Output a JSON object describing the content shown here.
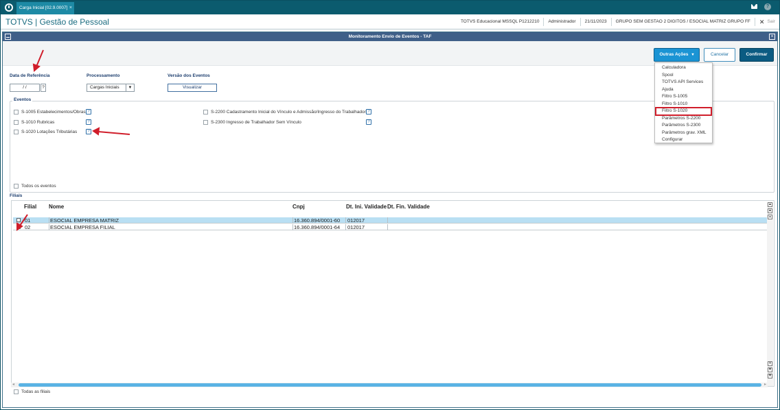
{
  "topbar": {
    "tab_label": "Carga Inicial [02.9.0007]",
    "tab_close": "×"
  },
  "module": {
    "title": "TOTVS | Gestão de Pessoal",
    "environment": "TOTVS Educacional MSSQL P1212210",
    "user": "Administrador",
    "date": "21/11/2023",
    "company": "GRUPO SEM GESTAO 2 DIGITOS / ESOCIAL MATRIZ GRUPO FF",
    "close": "✕",
    "exit": "Sair"
  },
  "dialog": {
    "title": "Monitoramento Envio de Eventos - TAF",
    "close": "×"
  },
  "actions": {
    "outras": "Outras Ações",
    "outras_chevron": "▾",
    "cancelar": "Cancelar",
    "confirmar": "Confirmar"
  },
  "menu": [
    "Calculadora",
    "Spool",
    "TOTVS API Services",
    "Ajuda",
    "Filtro S-1005",
    "Filtro S-1010",
    "Filtro S-1020",
    "Parâmetros S-2200",
    "Parâmetros S-2300",
    "Parâmetros grav. XML",
    "Configurar"
  ],
  "form": {
    "data_ref_label": "Data de Referência",
    "data_ref_value": " /  /",
    "help": "?",
    "processamento_label": "Processamento",
    "processamento_value": "Cargas Iniciais",
    "processamento_arrow": "▼",
    "versao_label": "Versão dos Eventos",
    "visualizar": "Visualizar"
  },
  "eventos": {
    "title": "Eventos",
    "items": [
      "S-1005 Estabelecimentos/Obras",
      "S-1010 Rubricas",
      "S-1020 Lotações Tributárias",
      "S-2200 Cadastramento Inicial do Vínculo e Admissão/Ingresso do Trabalhador",
      "S-2300 Ingresso de Trabalhador Sem Vínculo"
    ],
    "todos": "Todos os eventos"
  },
  "filiais": {
    "title": "Filiais",
    "columns": [
      "Filial",
      "Nome",
      "Cnpj",
      "Dt. Ini. Validade",
      "Dt. Fin. Validade"
    ],
    "rows": [
      {
        "filial": "01",
        "nome": "ESOCIAL EMPRESA MATRIZ",
        "cnpj": "16.360.894/0001-60",
        "ini": "012017",
        "fin": ""
      },
      {
        "filial": "02",
        "nome": "ESOCIAL EMPRESA FILIAL",
        "cnpj": "16.360.894/0001-64",
        "ini": "012017",
        "fin": ""
      }
    ],
    "todas": "Todas as filiais"
  },
  "colors": {
    "topbar": "#0b5b6e",
    "accent": "#1b94d4",
    "highlight": "#d01d2a",
    "selected_row": "#b9dff3"
  }
}
